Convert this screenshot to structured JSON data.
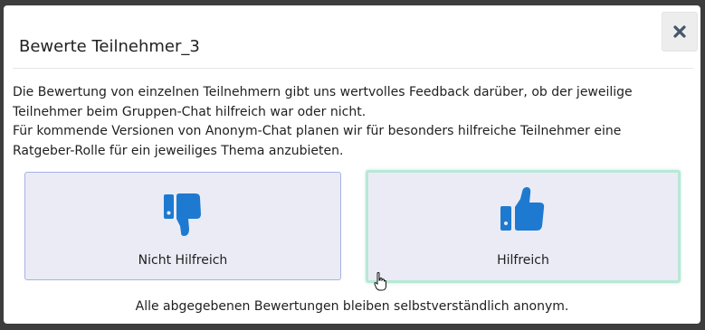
{
  "modal": {
    "title": "Bewerte Teilnehmer_3",
    "close_icon": "close-icon",
    "description_lines": [
      "Die Bewertung von einzelnen Teilnehmern gibt uns wertvolles Feedback darüber, ob der jeweilige Teilnehmer beim Gruppen-Chat hilfreich war oder nicht.",
      "Für kommende Versionen von Anonym-Chat planen wir für besonders hilfreiche Teilnehmer eine Ratgeber-Rolle für ein jeweiliges Thema anzubieten."
    ],
    "options": [
      {
        "label": "Nicht Hilfreich",
        "icon": "thumbs-down-icon",
        "selected": false
      },
      {
        "label": "Hilfreich",
        "icon": "thumbs-up-icon",
        "selected": true
      }
    ],
    "footer_note": "Alle abgegebenen Bewertungen bleiben selbstverständlich anonym."
  },
  "colors": {
    "icon_blue": "#1d7ad0",
    "card_bg": "#ebebf5",
    "selected_border": "#b8e8d6",
    "card_border": "#a9b1e6",
    "close_icon": "#45576a"
  }
}
